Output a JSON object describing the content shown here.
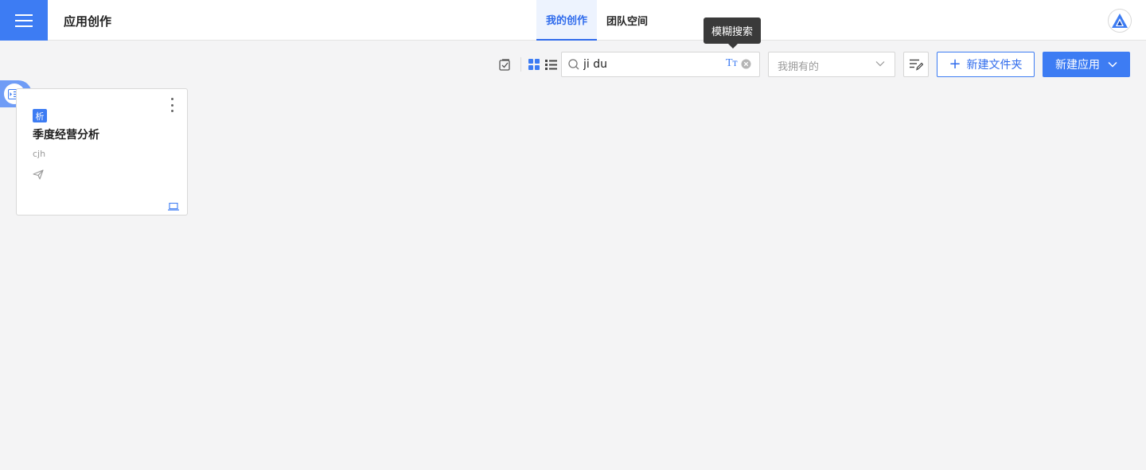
{
  "header": {
    "app_title": "应用创作",
    "tabs": [
      {
        "label": "我的创作",
        "active": true
      },
      {
        "label": "团队空间",
        "active": false
      }
    ]
  },
  "tooltip": {
    "text": "模糊搜索"
  },
  "toolbar": {
    "search_value": "ji du",
    "search_fuzzy_label": "Tт",
    "owner_filter_value": "我拥有的",
    "new_folder_label": "新建文件夹",
    "new_app_label": "新建应用"
  },
  "cards": [
    {
      "badge": "析",
      "title": "季度经营分析",
      "owner": "cjh"
    }
  ],
  "colors": {
    "primary": "#3d7cf3",
    "tab_active_bg": "#edf3fe",
    "page_bg": "#f4f4f5"
  },
  "icons": {
    "menu": "hamburger-menu-icon",
    "select_mode": "checkbox-icon",
    "grid_view": "grid-view-icon",
    "list_view": "list-view-icon",
    "search": "search-icon",
    "clear": "clear-circle-icon",
    "sort": "sort-edit-icon",
    "dropdown": "chevron-down-icon",
    "send": "send-icon",
    "device": "laptop-icon",
    "side_toggle": "indent-list-icon"
  }
}
